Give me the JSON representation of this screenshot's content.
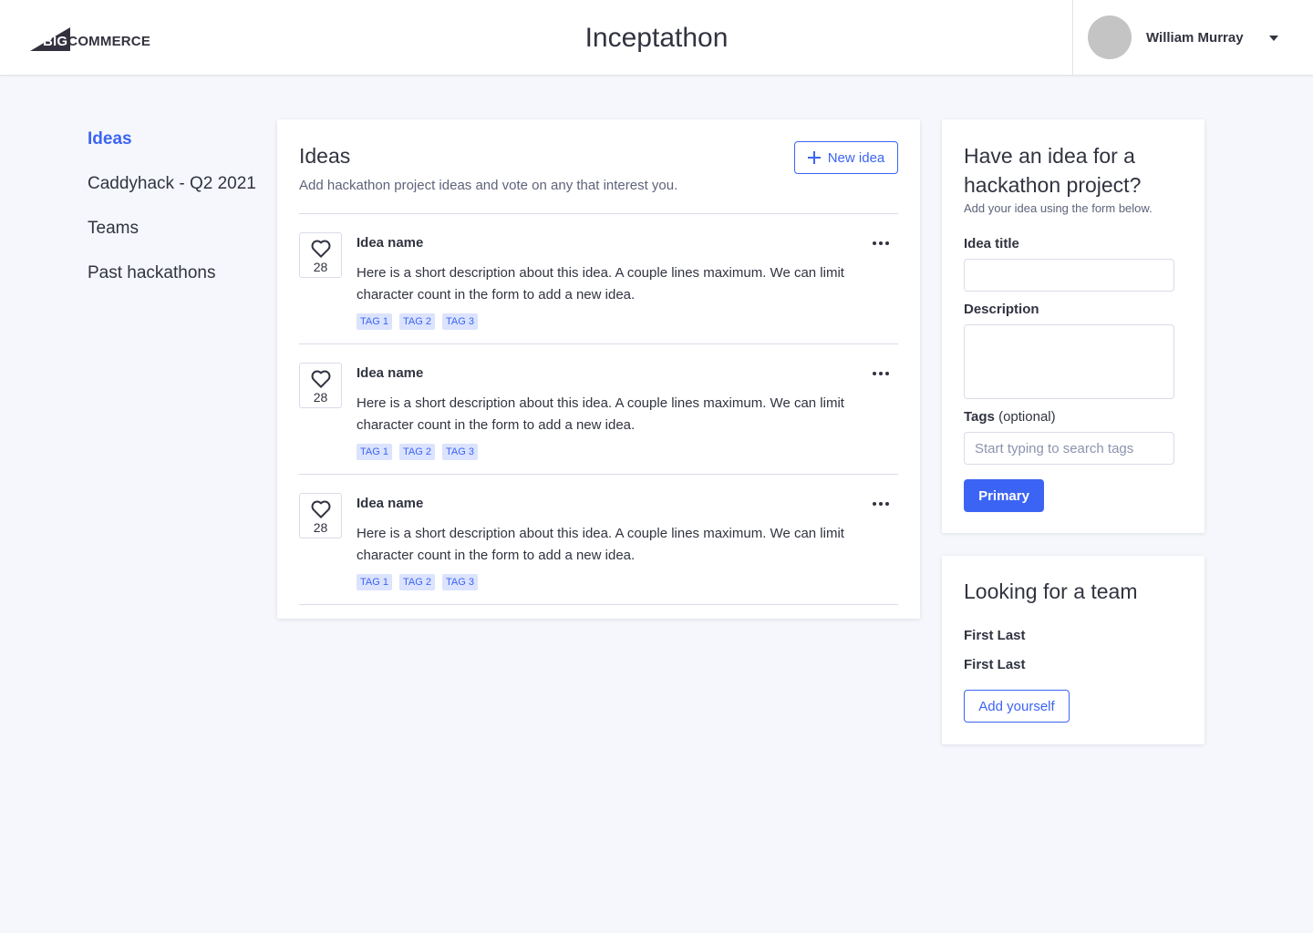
{
  "header": {
    "logo": {
      "big": "BIG",
      "rest": "COMMERCE"
    },
    "title": "Inceptathon",
    "user": {
      "name": "William Murray"
    }
  },
  "nav": {
    "items": [
      {
        "label": "Ideas",
        "active": true
      },
      {
        "label": "Caddyhack - Q2 2021",
        "active": false
      },
      {
        "label": "Teams",
        "active": false
      },
      {
        "label": "Past hackathons",
        "active": false
      }
    ]
  },
  "ideas": {
    "title": "Ideas",
    "subtitle": "Add hackathon project ideas and vote on any that interest you.",
    "new_idea_label": "New idea",
    "items": [
      {
        "votes": "28",
        "name": "Idea name",
        "description": "Here is a short description about this idea. A couple lines maximum. We can limit character count in the form to add a new idea.",
        "tags": [
          "TAG 1",
          "TAG 2",
          "TAG 3"
        ]
      },
      {
        "votes": "28",
        "name": "Idea name",
        "description": "Here is a short description about this idea. A couple lines maximum. We can limit character count in the form to add a new idea.",
        "tags": [
          "TAG 1",
          "TAG 2",
          "TAG 3"
        ]
      },
      {
        "votes": "28",
        "name": "Idea name",
        "description": "Here is a short description about this idea. A couple lines maximum. We can limit character count in the form to add a new idea.",
        "tags": [
          "TAG 1",
          "TAG 2",
          "TAG 3"
        ]
      }
    ]
  },
  "form": {
    "title": "Have an idea for a hackathon project?",
    "subtitle": "Add your idea using the form below.",
    "idea_title_label": "Idea title",
    "idea_title_value": "",
    "description_label": "Description",
    "description_value": "",
    "tags_label": "Tags",
    "tags_optional": "(optional)",
    "tags_placeholder": "Start typing to search tags",
    "submit_label": "Primary"
  },
  "team": {
    "title": "Looking for a team",
    "members": [
      "First Last",
      "First Last"
    ],
    "add_label": "Add yourself"
  },
  "colors": {
    "accent": "#3c64f4",
    "tag_bg": "#dbe3fe",
    "background": "#f5f7fc",
    "text": "#313440"
  },
  "icons": {
    "logo": "bigcommerce-logo",
    "plus": "plus-icon",
    "heart": "heart-icon",
    "more": "more-horizontal-icon",
    "caret": "chevron-down-icon"
  }
}
